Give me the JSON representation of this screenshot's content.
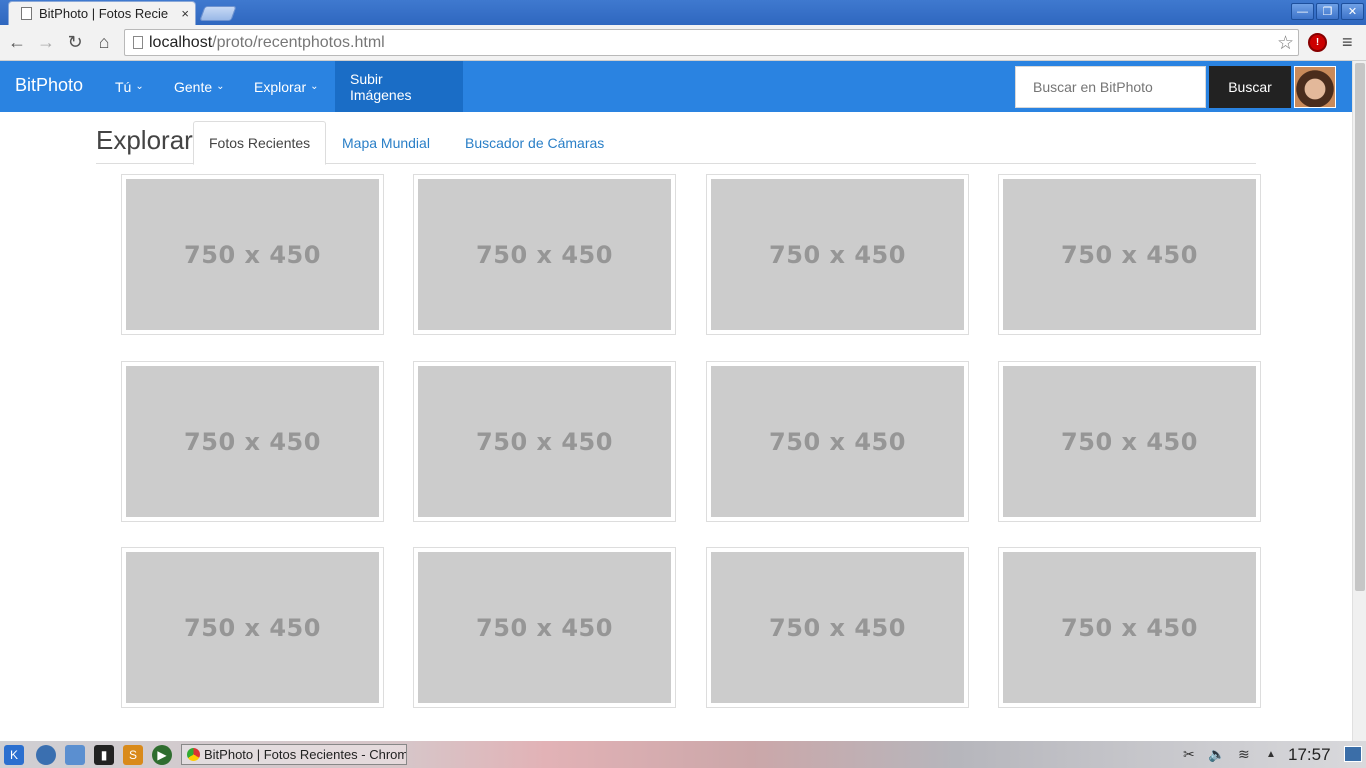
{
  "browser": {
    "tab_title": "BitPhoto | Fotos Recie",
    "tab_close": "×",
    "url_host": "localhost",
    "url_path": "/proto/recentphotos.html",
    "window_buttons": [
      "—",
      "❐",
      "✕"
    ],
    "nav": {
      "back": "←",
      "forward": "→",
      "reload": "↻",
      "home": "⌂"
    },
    "star": "☆",
    "menu": "≡",
    "extension": "!"
  },
  "navbar": {
    "brand": "BitPhoto",
    "items": [
      {
        "label": "Tú",
        "caret": "⌄"
      },
      {
        "label": "Gente",
        "caret": "⌄"
      },
      {
        "label": "Explorar",
        "caret": "⌄"
      },
      {
        "label": "Subir Imágenes",
        "caret": ""
      }
    ],
    "search_placeholder": "Buscar en BitPhoto",
    "search_button": "Buscar",
    "accent_color": "#2a83e1"
  },
  "explore": {
    "title": "Explorar",
    "tabs": [
      "Fotos Recientes",
      "Mapa Mundial",
      "Buscador de Cámaras"
    ]
  },
  "photos": [
    "750 x 450",
    "750 x 450",
    "750 x 450",
    "750 x 450",
    "750 x 450",
    "750 x 450",
    "750 x 450",
    "750 x 450",
    "750 x 450",
    "750 x 450",
    "750 x 450",
    "750 x 450"
  ],
  "taskbar": {
    "window_title": "BitPhoto | Fotos Recientes - Chromium",
    "clock": "17:57"
  }
}
